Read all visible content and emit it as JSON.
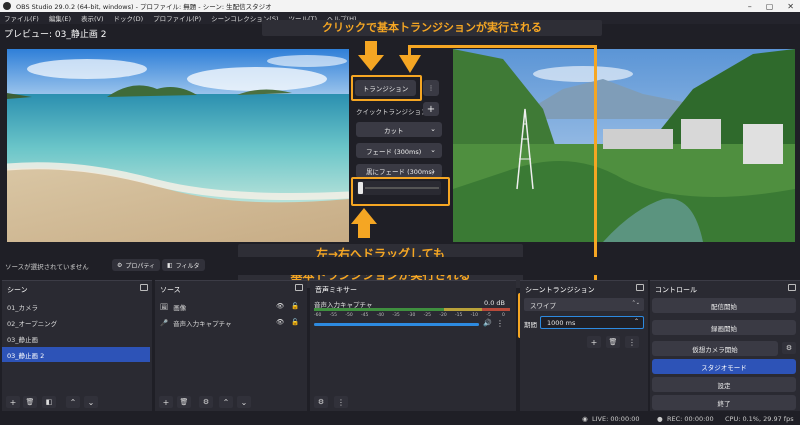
{
  "window": {
    "title": "OBS Studio 29.0.2 (64-bit, windows) - プロファイル: 無題 - シーン: 生配信スタジオ"
  },
  "menu": [
    "ファイル(F)",
    "編集(E)",
    "表示(V)",
    "ドック(D)",
    "プロファイル(P)",
    "シーンコレクション(S)",
    "ツール(T)",
    "ヘルプ(H)"
  ],
  "preview": {
    "label": "プレビュー: 03_静止画 2"
  },
  "transition_panel": {
    "transition_button": "トランジション",
    "quick_label": "クイックトランジション",
    "quick_items": [
      "カット",
      "フェード (300ms)",
      "黒にフェード (300ms)"
    ]
  },
  "annotations": {
    "top": "クリックで基本トランジションが実行される",
    "bottom_line1": "左→右へドラッグしても",
    "bottom_line2": "基本トランジションが実行される"
  },
  "source_toolbar": {
    "no_source": "ソースが選択されていません",
    "properties": "プロパティ",
    "filters": "フィルタ"
  },
  "scenes": {
    "title": "シーン",
    "items": [
      "01_カメラ",
      "02_オープニング",
      "03_静止画",
      "03_静止画 2"
    ],
    "selected": 3
  },
  "sources": {
    "title": "ソース",
    "items": [
      {
        "icon": "image-icon",
        "label": "画像"
      },
      {
        "icon": "mic-icon",
        "label": "音声入力キャプチャ"
      }
    ]
  },
  "mixer": {
    "title": "音声ミキサー",
    "channel": "音声入力キャプチャ",
    "db": "0.0 dB",
    "scale": [
      "-60",
      "-55",
      "-50",
      "-45",
      "-40",
      "-35",
      "-30",
      "-25",
      "-20",
      "-15",
      "-10",
      "-5",
      "0"
    ],
    "volume": 1.0
  },
  "scene_transition": {
    "title": "シーントランジション",
    "type": "スワイプ",
    "duration_label": "期間",
    "duration_value": "1000 ms"
  },
  "controls": {
    "title": "コントロール",
    "buttons": [
      "配信開始",
      "録画開始",
      "仮想カメラ開始",
      "スタジオモード",
      "設定",
      "終了"
    ],
    "active_index": 3
  },
  "status": {
    "live": "LIVE: 00:00:00",
    "rec": "REC: 00:00:00",
    "cpu": "CPU: 0.1%, 29.97 fps"
  },
  "colors": {
    "accent": "#2d53b7",
    "annotation": "#f5a623"
  }
}
